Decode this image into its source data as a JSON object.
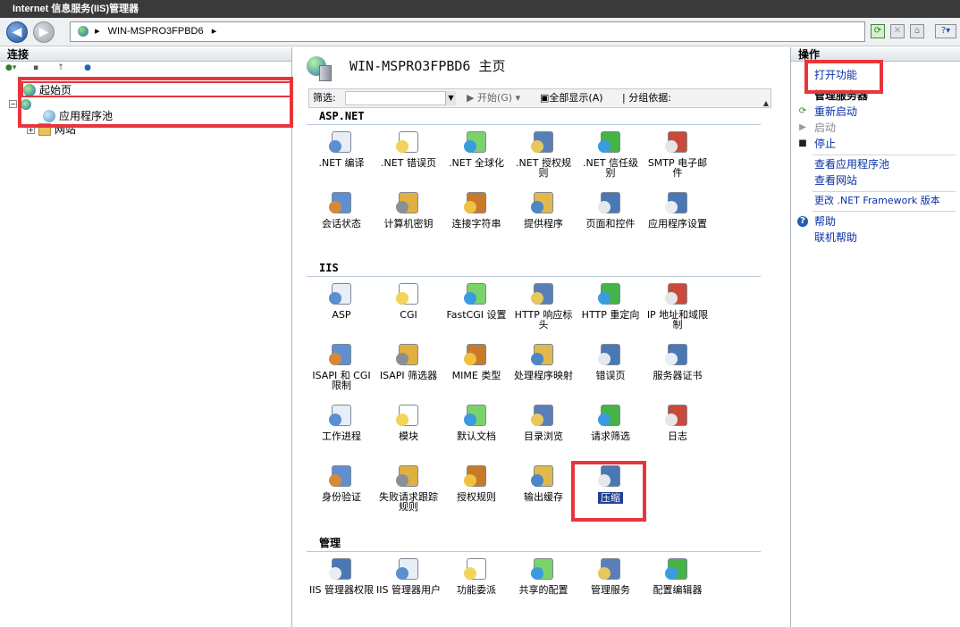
{
  "window": {
    "title": "Internet 信息服务(IIS)管理器"
  },
  "nav": {
    "back_icon": "back-arrow-icon",
    "forward_icon": "forward-arrow-icon",
    "breadcrumb": [
      "WIN-MSPRO3FPBD6"
    ],
    "breadcrumb_text": "WIN-MSPRO3FPBD6",
    "tools": [
      "refresh-icon",
      "stop-icon",
      "home-icon",
      "help-icon"
    ]
  },
  "connections": {
    "title": "连接",
    "tree": [
      {
        "label": "起始页",
        "icon": "start-page-icon"
      },
      {
        "label": "",
        "icon": "server-icon"
      },
      {
        "label": "应用程序池",
        "icon": "app-pool-icon"
      },
      {
        "label": "网站",
        "icon": "sites-folder-icon"
      }
    ]
  },
  "main": {
    "title": "WIN-MSPRO3FPBD6 主页",
    "filter": {
      "label": "筛选:",
      "start": "开始(G)",
      "show_all": "全部显示(A)",
      "group_by": "分组依据:"
    },
    "sections": [
      {
        "title": "ASP.NET",
        "items": [
          ".NET 编译",
          ".NET 错误页",
          ".NET 全球化",
          ".NET 授权规则",
          ".NET 信任级别",
          "SMTP 电子邮件",
          "会话状态",
          "计算机密钥",
          "连接字符串",
          "提供程序",
          "页面和控件",
          "应用程序设置"
        ]
      },
      {
        "title": "IIS",
        "items": [
          "ASP",
          "CGI",
          "FastCGI 设置",
          "HTTP 响应标头",
          "HTTP 重定向",
          "IP 地址和域限制",
          "ISAPI 和 CGI 限制",
          "ISAPI 筛选器",
          "MIME 类型",
          "处理程序映射",
          "错误页",
          "服务器证书",
          "工作进程",
          "模块",
          "默认文档",
          "目录浏览",
          "请求筛选",
          "日志",
          "身份验证",
          "失败请求跟踪规则",
          "授权规则",
          "输出缓存",
          "压缩"
        ]
      },
      {
        "title": "管理",
        "items": [
          "IIS 管理器权限",
          "IIS 管理器用户",
          "功能委派",
          "共享的配置",
          "管理服务",
          "配置编辑器"
        ]
      }
    ],
    "selected": "压缩"
  },
  "actions": {
    "title": "操作",
    "open_feature": "打开功能",
    "manage_server": "管理服务器",
    "restart": "重新启动",
    "start": "启动",
    "stop": "停止",
    "view_pools": "查看应用程序池",
    "view_sites": "查看网站",
    "change_net": "更改 .NET Framework 版本",
    "help": "帮助",
    "online_help": "联机帮助"
  },
  "colors": {
    "highlight": "#e8353c",
    "link": "#0b2fa6",
    "selection": "#1f3f92"
  }
}
